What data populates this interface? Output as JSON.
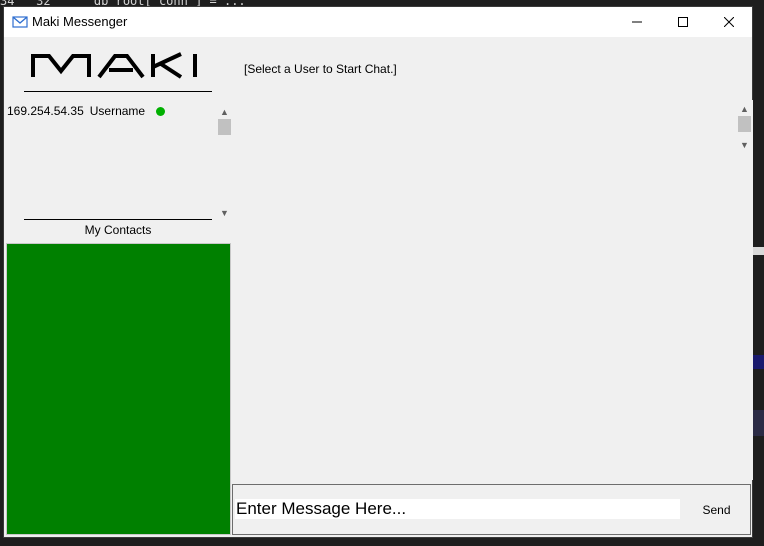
{
  "window": {
    "title": "Maki Messenger"
  },
  "logo": {
    "text": "MAKI"
  },
  "users": [
    {
      "ip": "169.254.54.35",
      "username": "Username",
      "status_color": "#00b000"
    }
  ],
  "contacts": {
    "label": "My Contacts",
    "panel_color": "#008000"
  },
  "chat": {
    "header": "[Select a User to Start Chat.]"
  },
  "composer": {
    "placeholder": "Enter Message Here...",
    "send_label": "Send"
  },
  "background": {
    "code_line": "34   32      db_root['conn'] = ..."
  }
}
